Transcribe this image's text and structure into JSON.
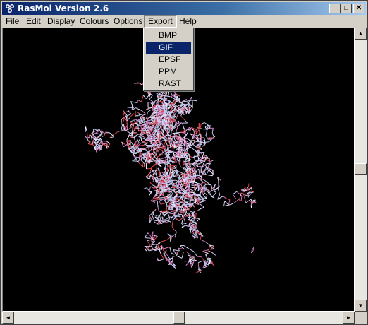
{
  "window": {
    "title": "RasMol Version 2.6",
    "controls": {
      "minimize": "_",
      "maximize": "□",
      "close": "✕"
    }
  },
  "menubar": {
    "items": [
      {
        "label": "File"
      },
      {
        "label": "Edit"
      },
      {
        "label": "Display"
      },
      {
        "label": "Colours"
      },
      {
        "label": "Options"
      },
      {
        "label": "Export"
      },
      {
        "label": "Help"
      }
    ],
    "active": "Export"
  },
  "export_menu": {
    "items": [
      "BMP",
      "GIF",
      "EPSF",
      "PPM",
      "RAST"
    ],
    "selected": "GIF"
  },
  "canvas": {
    "background": "#000000",
    "content": "molecule-wireframe"
  },
  "scrollbars": {
    "vertical": {
      "up": "▲",
      "down": "▼"
    },
    "horizontal": {
      "left": "◄",
      "right": "►"
    }
  },
  "colors": {
    "title_start": "#0a246a",
    "title_end": "#a6caf0",
    "selection": "#0a246a",
    "bond_light": "#c8c8f0",
    "bond_red": "#e04040"
  }
}
